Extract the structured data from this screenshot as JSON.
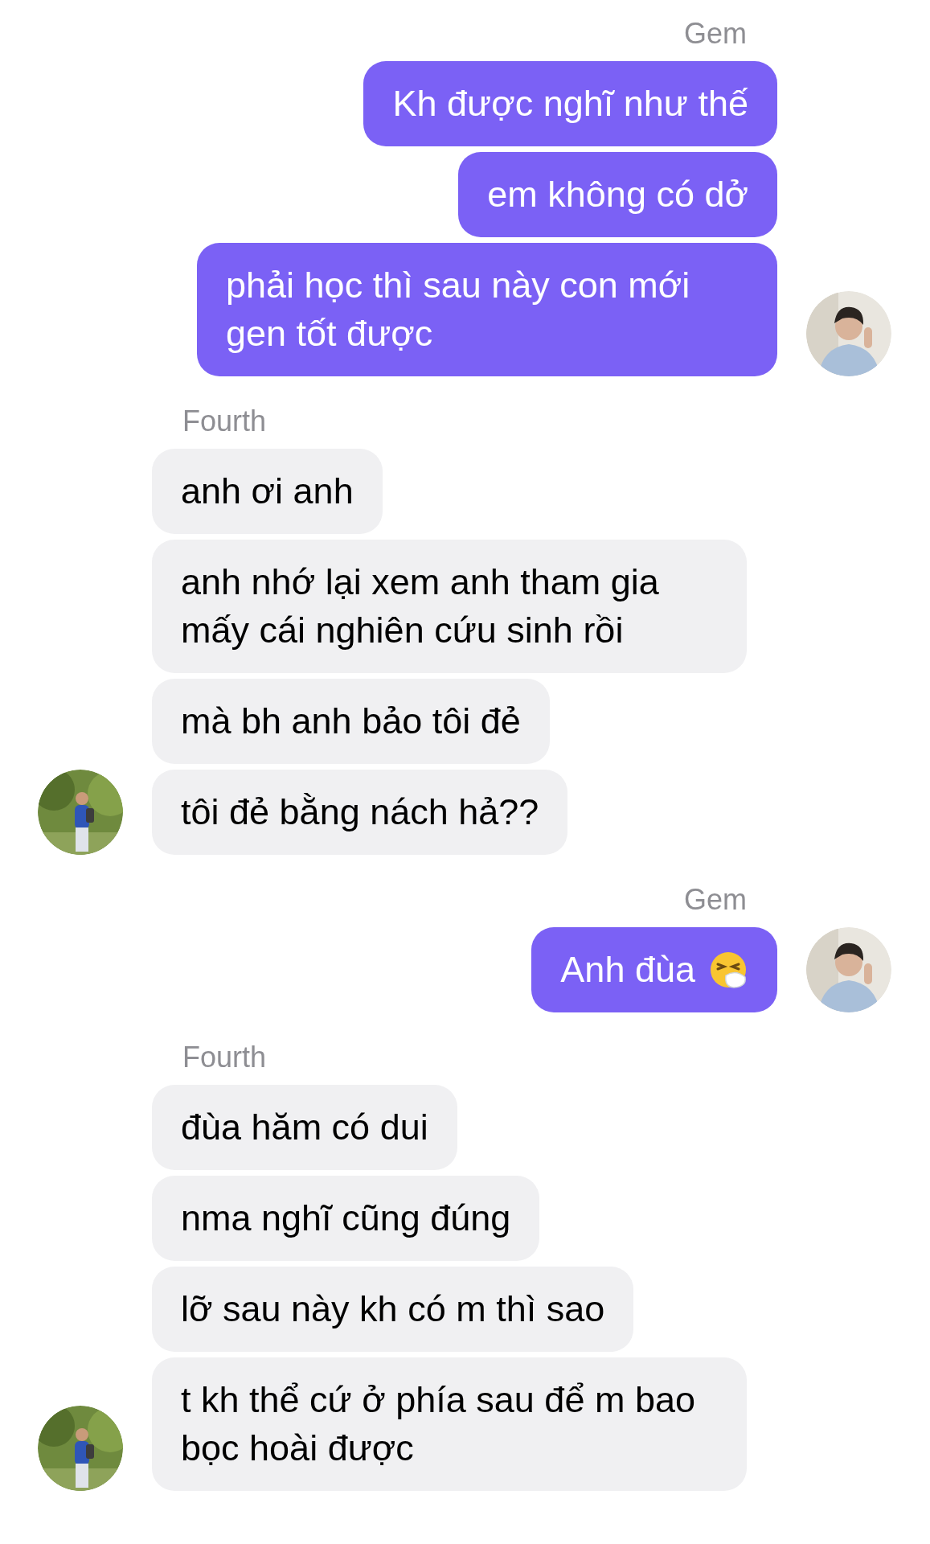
{
  "groups": [
    {
      "kind": "outgoing",
      "sender": "Gem",
      "messages": [
        {
          "kind": "plain",
          "text": "Kh được nghĩ như thế"
        },
        {
          "kind": "plain",
          "text": "em không có dở"
        },
        {
          "kind": "plain",
          "text": "phải học thì sau này con mới gen tốt được"
        }
      ]
    },
    {
      "kind": "incoming",
      "sender": "Fourth",
      "messages": [
        {
          "kind": "plain",
          "text": "anh ơi anh"
        },
        {
          "kind": "plain",
          "text": "anh nhớ lại xem anh tham gia mấy cái nghiên cứu sinh rồi"
        },
        {
          "kind": "plain",
          "text": "mà bh anh bảo tôi đẻ"
        },
        {
          "kind": "plain",
          "text": "tôi đẻ bằng nách hả??"
        }
      ]
    },
    {
      "kind": "outgoing",
      "sender": "Gem",
      "messages": [
        {
          "kind": "sneeze",
          "text": "Anh đùa"
        }
      ]
    },
    {
      "kind": "incoming",
      "sender": "Fourth",
      "messages": [
        {
          "kind": "plain",
          "text": "đùa hăm có dui"
        },
        {
          "kind": "plain",
          "text": "nma nghĩ cũng đúng"
        },
        {
          "kind": "plain",
          "text": "lỡ sau này kh có m thì sao"
        },
        {
          "kind": "plain",
          "text": "t kh thể cứ ở phía sau để m bao bọc hoài được"
        }
      ]
    }
  ]
}
